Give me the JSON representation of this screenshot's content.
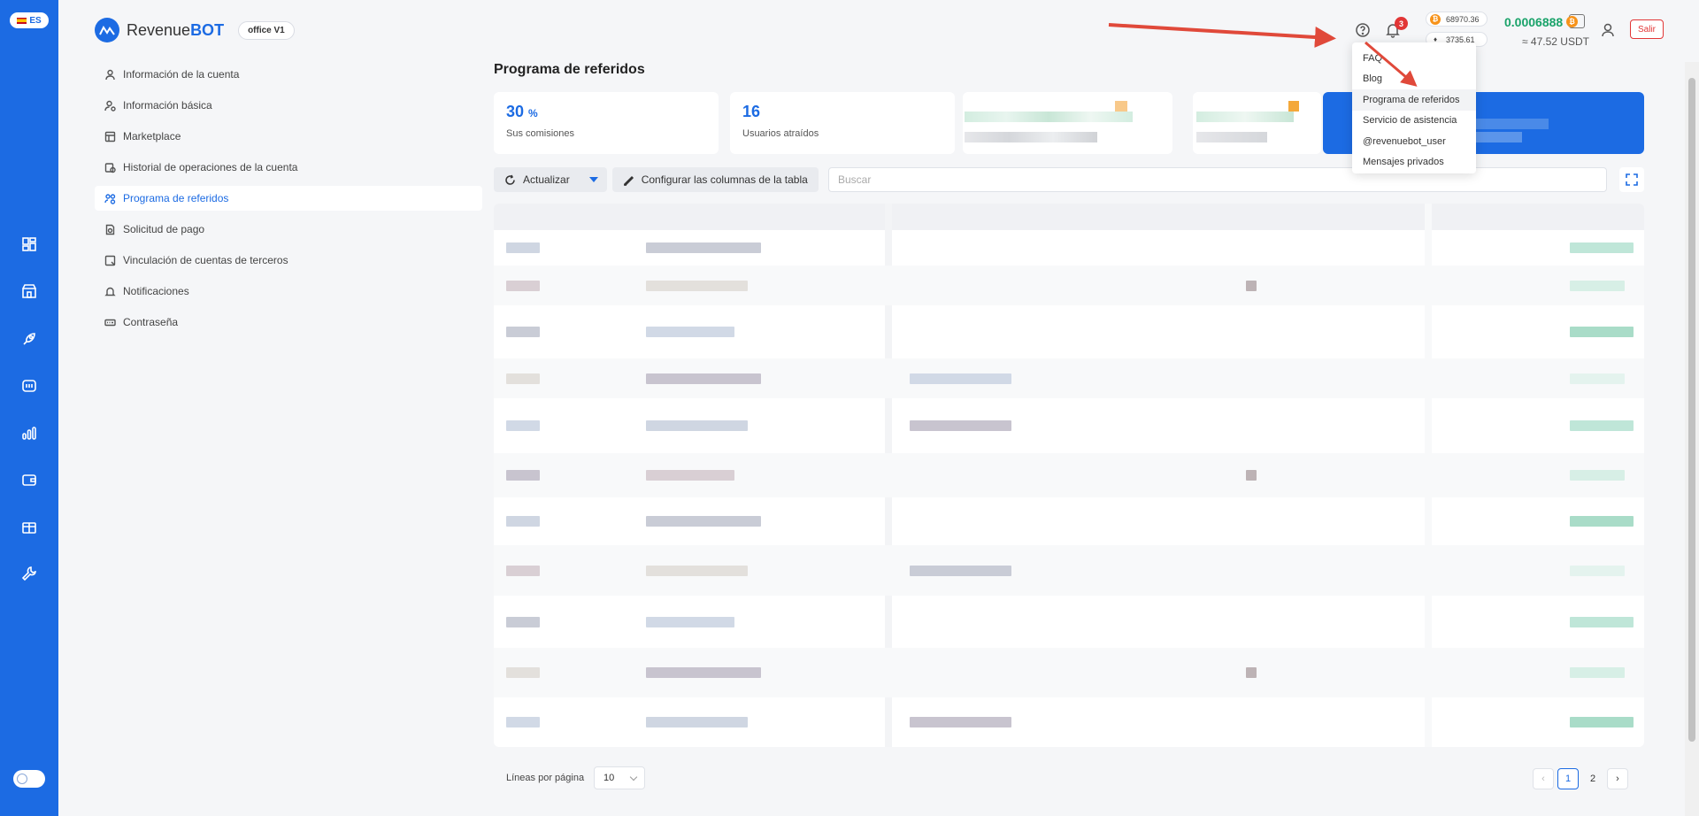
{
  "language": "ES",
  "logo": {
    "text_a": "Revenue",
    "text_b": "BOT",
    "badge": "office V1"
  },
  "header": {
    "notifications_count": "3",
    "btc_rate": "68970.36",
    "eth_rate": "3735.61",
    "balance": "0.0006888",
    "balance_usdt": "≈ 47.52 USDT",
    "exit_label": "Salir"
  },
  "help_menu": {
    "items": [
      "FAQ",
      "Blog",
      "Programa de referidos",
      "Servicio de asistencia",
      "@revenuebot_user",
      "Mensajes privados"
    ],
    "highlighted": "Programa de referidos"
  },
  "rail_icons": [
    "dashboard-icon",
    "store-icon",
    "rocket-icon",
    "terminal-icon",
    "chart-icon",
    "wallet-icon",
    "gift-icon",
    "wrench-icon"
  ],
  "sidebar": {
    "items": [
      {
        "label": "Información de la cuenta",
        "icon": "user-icon"
      },
      {
        "label": "Información básica",
        "icon": "user-settings-icon"
      },
      {
        "label": "Marketplace",
        "icon": "marketplace-icon"
      },
      {
        "label": "Historial de operaciones de la cuenta",
        "icon": "history-icon"
      },
      {
        "label": "Programa de referidos",
        "icon": "referral-icon",
        "active": true
      },
      {
        "label": "Solicitud de pago",
        "icon": "payment-request-icon"
      },
      {
        "label": "Vinculación de cuentas de terceros",
        "icon": "link-accounts-icon"
      },
      {
        "label": "Notificaciones",
        "icon": "bell-icon"
      },
      {
        "label": "Contraseña",
        "icon": "password-icon"
      }
    ]
  },
  "main": {
    "title": "Programa de referidos",
    "stats": [
      {
        "value": "30",
        "unit": "%",
        "label": "Sus comisiones"
      },
      {
        "value": "16",
        "unit": "",
        "label": "Usuarios atraídos"
      }
    ],
    "toolbar": {
      "refresh_label": "Actualizar",
      "columns_label": "Configurar las columnas de la tabla",
      "search_placeholder": "Buscar"
    },
    "pagination": {
      "rows_label": "Líneas por página",
      "rows_value": "10",
      "pages": [
        "1",
        "2"
      ],
      "current_page": "1"
    }
  },
  "colors": {
    "brand": "#1c6be3",
    "balance": "#1aa36a",
    "danger": "#e23636",
    "annotation": "#e0493a"
  }
}
